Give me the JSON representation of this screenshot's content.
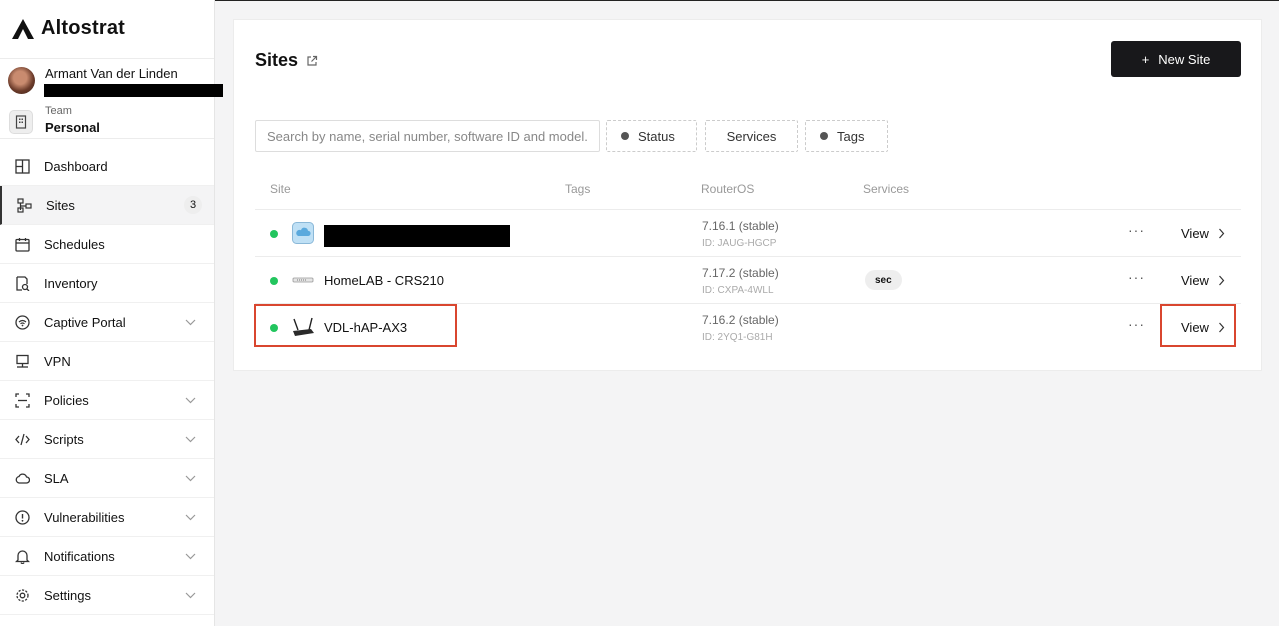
{
  "app": {
    "name": "Altostrat"
  },
  "user": {
    "name": "Armant Van der Linden"
  },
  "team": {
    "label": "Team",
    "value": "Personal"
  },
  "nav": [
    {
      "label": "Dashboard",
      "icon": "dashboard-icon"
    },
    {
      "label": "Sites",
      "icon": "sites-icon",
      "badge": "3",
      "active": true
    },
    {
      "label": "Schedules",
      "icon": "calendar-icon"
    },
    {
      "label": "Inventory",
      "icon": "inventory-icon"
    },
    {
      "label": "Captive Portal",
      "icon": "wifi-icon",
      "expandable": true
    },
    {
      "label": "VPN",
      "icon": "vpn-icon"
    },
    {
      "label": "Policies",
      "icon": "policies-icon",
      "expandable": true
    },
    {
      "label": "Scripts",
      "icon": "code-icon",
      "expandable": true
    },
    {
      "label": "SLA",
      "icon": "sla-icon",
      "expandable": true
    },
    {
      "label": "Vulnerabilities",
      "icon": "shield-alert-icon",
      "expandable": true
    },
    {
      "label": "Notifications",
      "icon": "bell-icon",
      "expandable": true
    },
    {
      "label": "Settings",
      "icon": "gear-icon",
      "expandable": true
    }
  ],
  "page": {
    "title": "Sites",
    "new_site_label": "New Site",
    "search_placeholder": "Search by name, serial number, software ID and model...",
    "filters": {
      "status": "Status",
      "services": "Services",
      "tags": "Tags"
    },
    "columns": {
      "site": "Site",
      "tags": "Tags",
      "routeros": "RouterOS",
      "services": "Services"
    },
    "rows": [
      {
        "name": "",
        "routeros": "7.16.1 (stable)",
        "id": "ID: JAUG-HGCP",
        "services": "",
        "view": "View",
        "icon": "cloud-device-icon"
      },
      {
        "name": "HomeLAB - CRS210",
        "routeros": "7.17.2 (stable)",
        "id": "ID: CXPA-4WLL",
        "services": "sec",
        "view": "View",
        "icon": "switch-device-icon"
      },
      {
        "name": "VDL-hAP-AX3",
        "routeros": "7.16.2 (stable)",
        "id": "ID: 2YQ1-G81H",
        "services": "",
        "view": "View",
        "icon": "router-device-icon"
      }
    ],
    "more_label": "···"
  },
  "colors": {
    "status_online": "#22c55e",
    "primary_button": "#18181b",
    "highlight": "#d9462f"
  }
}
